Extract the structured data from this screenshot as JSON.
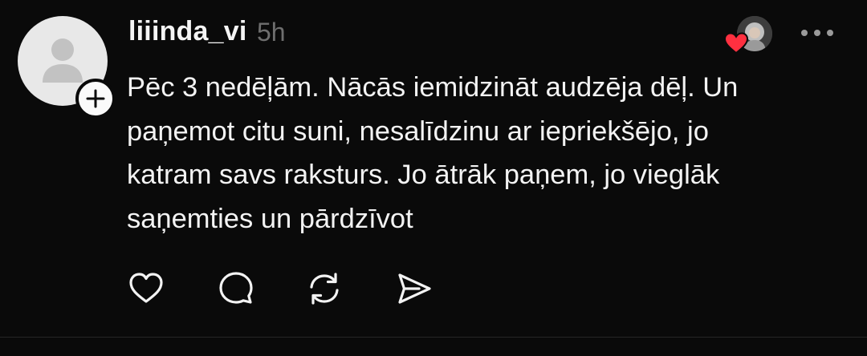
{
  "post": {
    "author": {
      "username": "liiinda_vi",
      "timestamp": "5h"
    },
    "content": "Pēc 3 nedēļām. Nācās iemidzināt audzēja dēļ. Un\npaņemot citu suni, nesalīdzinu ar iepriekšējo, jo\nkatram savs raksturs. Jo ātrāk paņem, jo vieglāk\nsaņemties un pārdzīvot",
    "icons": {
      "avatar": "default-avatar-icon",
      "follow": "plus-icon",
      "liked_by": "heart-icon",
      "more": "more-horizontal-icon",
      "like": "heart-outline-icon",
      "comment": "comment-icon",
      "repost": "repost-icon",
      "share": "send-icon"
    },
    "colors": {
      "background": "#0a0a0a",
      "text": "#f3f3f3",
      "timestamp": "#6e6e6e",
      "heart": "#ff3040"
    }
  }
}
